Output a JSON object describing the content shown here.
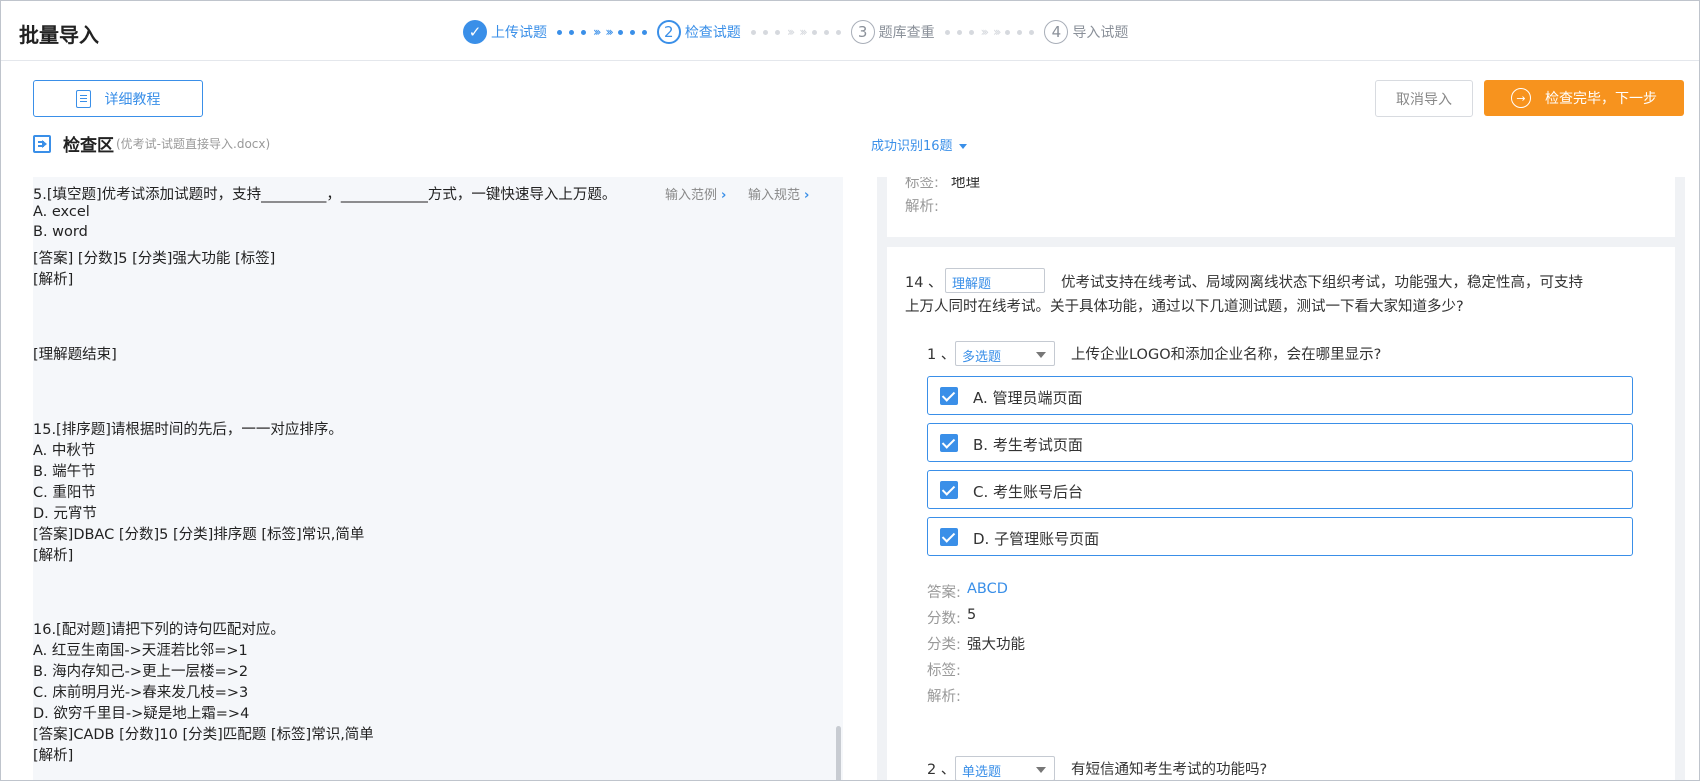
{
  "header": {
    "title": "批量导入",
    "steps": [
      {
        "num": "✓",
        "label": "上传试题",
        "state": "done"
      },
      {
        "num": "2",
        "label": "检查试题",
        "state": "active"
      },
      {
        "num": "3",
        "label": "题库查重",
        "state": "todo"
      },
      {
        "num": "4",
        "label": "导入试题",
        "state": "todo"
      }
    ]
  },
  "toolbar": {
    "tutorial_label": "详细教程",
    "cancel_label": "取消导入",
    "next_label": "检查完毕，下一步"
  },
  "check_area": {
    "title": "检查区",
    "file": "(优考试-试题直接导入.docx)",
    "success_label": "成功识别16题"
  },
  "editor": {
    "lines": [
      "5.[填空题]优考试添加试题时，支持_________，____________方式，一键快速导入上万题。",
      "A. excel",
      "B. word",
      "[答案]    [分数]5    [分类]强大功能    [标签]",
      "[解析]",
      "[理解题结束]",
      "15.[排序题]请根据时间的先后，一一对应排序。",
      "A. 中秋节",
      "B. 端午节",
      "C. 重阳节",
      "D. 元宵节",
      "[答案]DBAC    [分数]5    [分类]排序题    [标签]常识,简单",
      "[解析]",
      "16.[配对题]请把下列的诗句匹配对应。",
      "A. 红豆生南国->天涯若比邻=>1",
      "B. 海内存知己->更上一层楼=>2",
      "C. 床前明月光->春来发几枝=>3",
      "D. 欲穷千里目->疑是地上霜=>4",
      "[答案]CADB    [分数]10    [分类]匹配题    [标签]常识,简单",
      "[解析]"
    ],
    "example_link": "输入范例",
    "rule_link": "输入规范"
  },
  "preview": {
    "prev_card": {
      "tag_label": "标签:",
      "tag_value": "地理",
      "analysis_label": "解析:"
    },
    "q14": {
      "num": "14 、",
      "type": "理解题",
      "text_line1": "优考试支持在线考试、局域网离线状态下组织考试，功能强大，稳定性高，可支持",
      "text_line2": "上万人同时在线考试。关于具体功能，通过以下几道测试题，测试一下看大家知道多少?",
      "sub1": {
        "num": "1 、",
        "type": "多选题",
        "text": "上传企业LOGO和添加企业名称，会在哪里显示?",
        "options": [
          "A. 管理员端页面",
          "B. 考生考试页面",
          "C. 考生账号后台",
          "D. 子管理账号页面"
        ],
        "answer_label": "答案:",
        "answer": "ABCD",
        "score_label": "分数:",
        "score": "5",
        "category_label": "分类:",
        "category": "强大功能",
        "tag_label": "标签:",
        "analysis_label": "解析:"
      },
      "sub2": {
        "num": "2 、",
        "type": "单选题",
        "text": "有短信通知考生考试的功能吗?"
      }
    }
  },
  "colors": {
    "accent": "#3a8fe8",
    "primary_button": "#f7931e"
  }
}
